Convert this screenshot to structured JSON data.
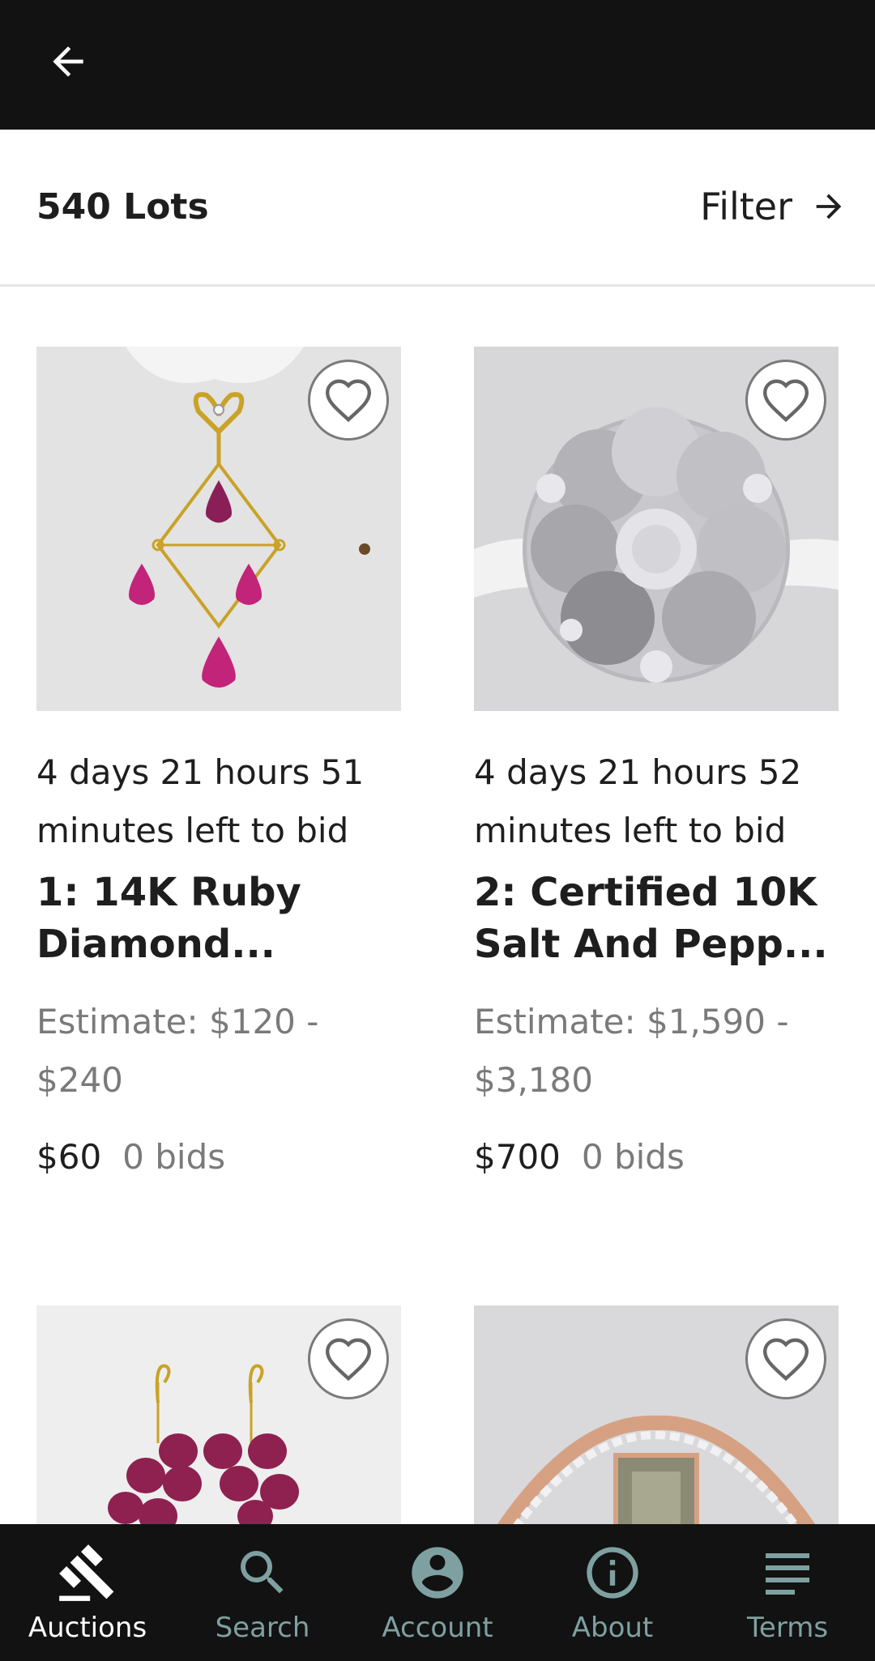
{
  "top_bar": {
    "back_icon": "arrow-left-icon"
  },
  "lots_header": {
    "count_label": "540 Lots",
    "filter_label": "Filter",
    "filter_icon": "arrow-right-icon"
  },
  "lots": [
    {
      "time_left": "4 days 21 hours 51 minutes left to bid",
      "title": "1: 14K Ruby Diamond...",
      "estimate": "Estimate: $120 - $240",
      "price": "$60",
      "bids": "0 bids",
      "favorite_icon": "heart-outline-icon"
    },
    {
      "time_left": "4 days 21 hours 52 minutes left to bid",
      "title": "2: Certified 10K Salt And Pepp...",
      "estimate": "Estimate: $1,590 - $3,180",
      "price": "$700",
      "bids": "0 bids",
      "favorite_icon": "heart-outline-icon"
    },
    {
      "favorite_icon": "heart-outline-icon"
    },
    {
      "favorite_icon": "heart-outline-icon"
    }
  ],
  "bottom_nav": {
    "items": [
      {
        "label": "Auctions",
        "icon": "gavel-icon",
        "active": true
      },
      {
        "label": "Search",
        "icon": "search-icon",
        "active": false
      },
      {
        "label": "Account",
        "icon": "account-circle-icon",
        "active": false
      },
      {
        "label": "About",
        "icon": "info-icon",
        "active": false
      },
      {
        "label": "Terms",
        "icon": "list-lines-icon",
        "active": false
      }
    ]
  },
  "colors": {
    "bar_background": "#121212",
    "nav_inactive": "#7fa0a0",
    "nav_active": "#ffffff",
    "muted_text": "#7a7a7a",
    "primary_text": "#1e1e1e"
  }
}
